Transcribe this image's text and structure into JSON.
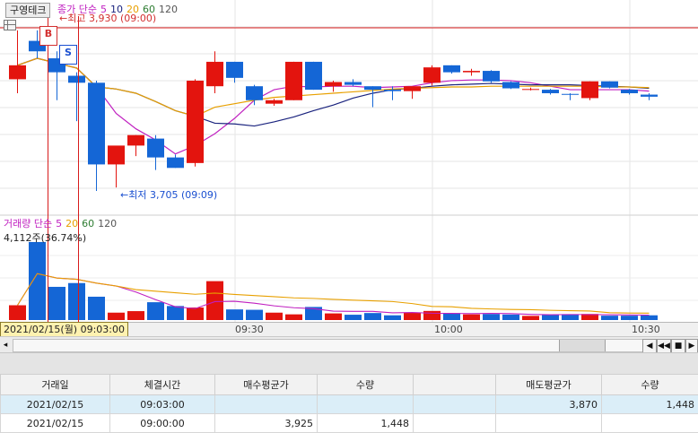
{
  "stock": {
    "name": "구영테크"
  },
  "price_legend": {
    "label": "종가 단순",
    "periods": [
      "5",
      "10",
      "20",
      "60",
      "120"
    ],
    "colors": [
      "#c020c0",
      "#1a237e",
      "#e8a000",
      "#2e7d32",
      "#555555"
    ]
  },
  "volume_legend": {
    "label": "거래량 단순",
    "periods": [
      "5",
      "20",
      "60",
      "120"
    ],
    "colors": [
      "#c020c0",
      "#e8a000",
      "#2e7d32",
      "#555555"
    ]
  },
  "volume_info": "4,112주(36.74%)",
  "annotations": {
    "high": "최고 3,930 (09:00)",
    "low": "최저 3,705 (09:09)",
    "buy_marker": "B",
    "sell_marker": "S"
  },
  "time_axis": {
    "cursor_label": "2021/02/15(월) 09:03:00",
    "labels": [
      "09:30",
      "10:00",
      "10:30"
    ]
  },
  "nav_buttons": [
    "◀",
    "◀◀",
    "■",
    "▶"
  ],
  "colors": {
    "up": "#e3140e",
    "down": "#1466d6",
    "cursor_line": "#d81b1b",
    "selected_row": "#dbeef8"
  },
  "chart_data": {
    "type": "candlestick",
    "price_range": [
      3700,
      3935
    ],
    "candles": [
      {
        "o": 3860,
        "h": 3930,
        "l": 3840,
        "c": 3880
      },
      {
        "o": 3915,
        "h": 3930,
        "l": 3890,
        "c": 3900
      },
      {
        "o": 3890,
        "h": 3900,
        "l": 3830,
        "c": 3870
      },
      {
        "o": 3865,
        "h": 3870,
        "l": 3800,
        "c": 3855
      },
      {
        "o": 3855,
        "h": 3858,
        "l": 3700,
        "c": 3738
      },
      {
        "o": 3738,
        "h": 3755,
        "l": 3705,
        "c": 3765
      },
      {
        "o": 3765,
        "h": 3780,
        "l": 3750,
        "c": 3780
      },
      {
        "o": 3775,
        "h": 3780,
        "l": 3730,
        "c": 3748
      },
      {
        "o": 3748,
        "h": 3752,
        "l": 3733,
        "c": 3733
      },
      {
        "o": 3740,
        "h": 3860,
        "l": 3735,
        "c": 3858
      },
      {
        "o": 3850,
        "h": 3900,
        "l": 3840,
        "c": 3885
      },
      {
        "o": 3885,
        "h": 3885,
        "l": 3855,
        "c": 3862
      },
      {
        "o": 3850,
        "h": 3852,
        "l": 3823,
        "c": 3830
      },
      {
        "o": 3825,
        "h": 3832,
        "l": 3822,
        "c": 3830
      },
      {
        "o": 3830,
        "h": 3885,
        "l": 3830,
        "c": 3885
      },
      {
        "o": 3885,
        "h": 3885,
        "l": 3845,
        "c": 3845
      },
      {
        "o": 3850,
        "h": 3858,
        "l": 3842,
        "c": 3856
      },
      {
        "o": 3856,
        "h": 3860,
        "l": 3850,
        "c": 3852
      },
      {
        "o": 3850,
        "h": 3850,
        "l": 3820,
        "c": 3845
      },
      {
        "o": 3845,
        "h": 3850,
        "l": 3830,
        "c": 3843
      },
      {
        "o": 3843,
        "h": 3845,
        "l": 3832,
        "c": 3850
      },
      {
        "o": 3855,
        "h": 3880,
        "l": 3851,
        "c": 3877
      },
      {
        "o": 3880,
        "h": 3880,
        "l": 3868,
        "c": 3870
      },
      {
        "o": 3870,
        "h": 3875,
        "l": 3865,
        "c": 3872
      },
      {
        "o": 3872,
        "h": 3873,
        "l": 3855,
        "c": 3857
      },
      {
        "o": 3856,
        "h": 3857,
        "l": 3846,
        "c": 3847
      },
      {
        "o": 3846,
        "h": 3848,
        "l": 3844,
        "c": 3846
      },
      {
        "o": 3845,
        "h": 3846,
        "l": 3838,
        "c": 3840
      },
      {
        "o": 3839,
        "h": 3840,
        "l": 3830,
        "c": 3838
      },
      {
        "o": 3833,
        "h": 3857,
        "l": 3830,
        "c": 3857
      },
      {
        "o": 3857,
        "h": 3857,
        "l": 3847,
        "c": 3848
      },
      {
        "o": 3845,
        "h": 3846,
        "l": 3838,
        "c": 3840
      },
      {
        "o": 3838,
        "h": 3840,
        "l": 3830,
        "c": 3835
      }
    ],
    "volume_range": [
      0,
      4300
    ],
    "volumes": [
      780,
      4112,
      1750,
      1950,
      1230,
      390,
      470,
      940,
      740,
      660,
      2050,
      560,
      540,
      390,
      300,
      690,
      350,
      280,
      370,
      250,
      390,
      480,
      370,
      300,
      320,
      290,
      220,
      280,
      310,
      320,
      230,
      230,
      250
    ],
    "ma_price": [
      {
        "period": "5",
        "color": "#c020c0",
        "values": [
          3880,
          3890,
          3883,
          3876,
          3849,
          3811,
          3789,
          3773,
          3753,
          3765,
          3782,
          3804,
          3830,
          3845,
          3850,
          3849,
          3850,
          3850,
          3848,
          3849,
          3850,
          3855,
          3858,
          3859,
          3859,
          3858,
          3855,
          3850,
          3845,
          3845,
          3845,
          3845,
          3843
        ]
      },
      {
        "period": "10",
        "color": "#1a237e",
        "values": [
          3880,
          3890,
          3883,
          3876,
          3849,
          3846,
          3840,
          3828,
          3815,
          3807,
          3797,
          3796,
          3793,
          3799,
          3806,
          3815,
          3823,
          3833,
          3840,
          3845,
          3847,
          3850,
          3852,
          3853,
          3854,
          3853,
          3852,
          3852,
          3852,
          3851,
          3850,
          3849,
          3847
        ]
      },
      {
        "period": "20",
        "color": "#e8a000",
        "values": [
          3880,
          3890,
          3883,
          3876,
          3849,
          3846,
          3840,
          3828,
          3815,
          3807,
          3820,
          3825,
          3830,
          3834,
          3836,
          3838,
          3840,
          3842,
          3844,
          3846,
          3847,
          3848,
          3849,
          3849,
          3850,
          3850,
          3850,
          3850,
          3850,
          3850,
          3849,
          3849,
          3848
        ]
      }
    ],
    "ma_volume": [
      {
        "period": "5",
        "color": "#c020c0",
        "values": [
          780,
          2446,
          2214,
          2148,
          1948,
          1794,
          1478,
          1076,
          701,
          603,
          970,
          990,
          890,
          750,
          650,
          600,
          470,
          460,
          460,
          380,
          400,
          360,
          350,
          340,
          350,
          340,
          300,
          280,
          290,
          290,
          280,
          270,
          260
        ]
      },
      {
        "period": "20",
        "color": "#e8a000",
        "values": [
          780,
          2446,
          2214,
          2148,
          1948,
          1794,
          1605,
          1523,
          1436,
          1359,
          1422,
          1351,
          1289,
          1232,
          1170,
          1140,
          1092,
          1047,
          1011,
          975,
          868,
          716,
          698,
          616,
          585,
          557,
          545,
          514,
          493,
          476,
          385,
          370,
          363
        ]
      }
    ]
  },
  "trades_table": {
    "headers": [
      "거래일",
      "체결시간",
      "매수평균가",
      "수량",
      "",
      "매도평균가",
      "수량"
    ],
    "rows": [
      [
        "2021/02/15",
        "09:03:00",
        "",
        "",
        "",
        "3,870",
        "1,448"
      ],
      [
        "2021/02/15",
        "09:00:00",
        "3,925",
        "1,448",
        "",
        "",
        ""
      ]
    ]
  }
}
